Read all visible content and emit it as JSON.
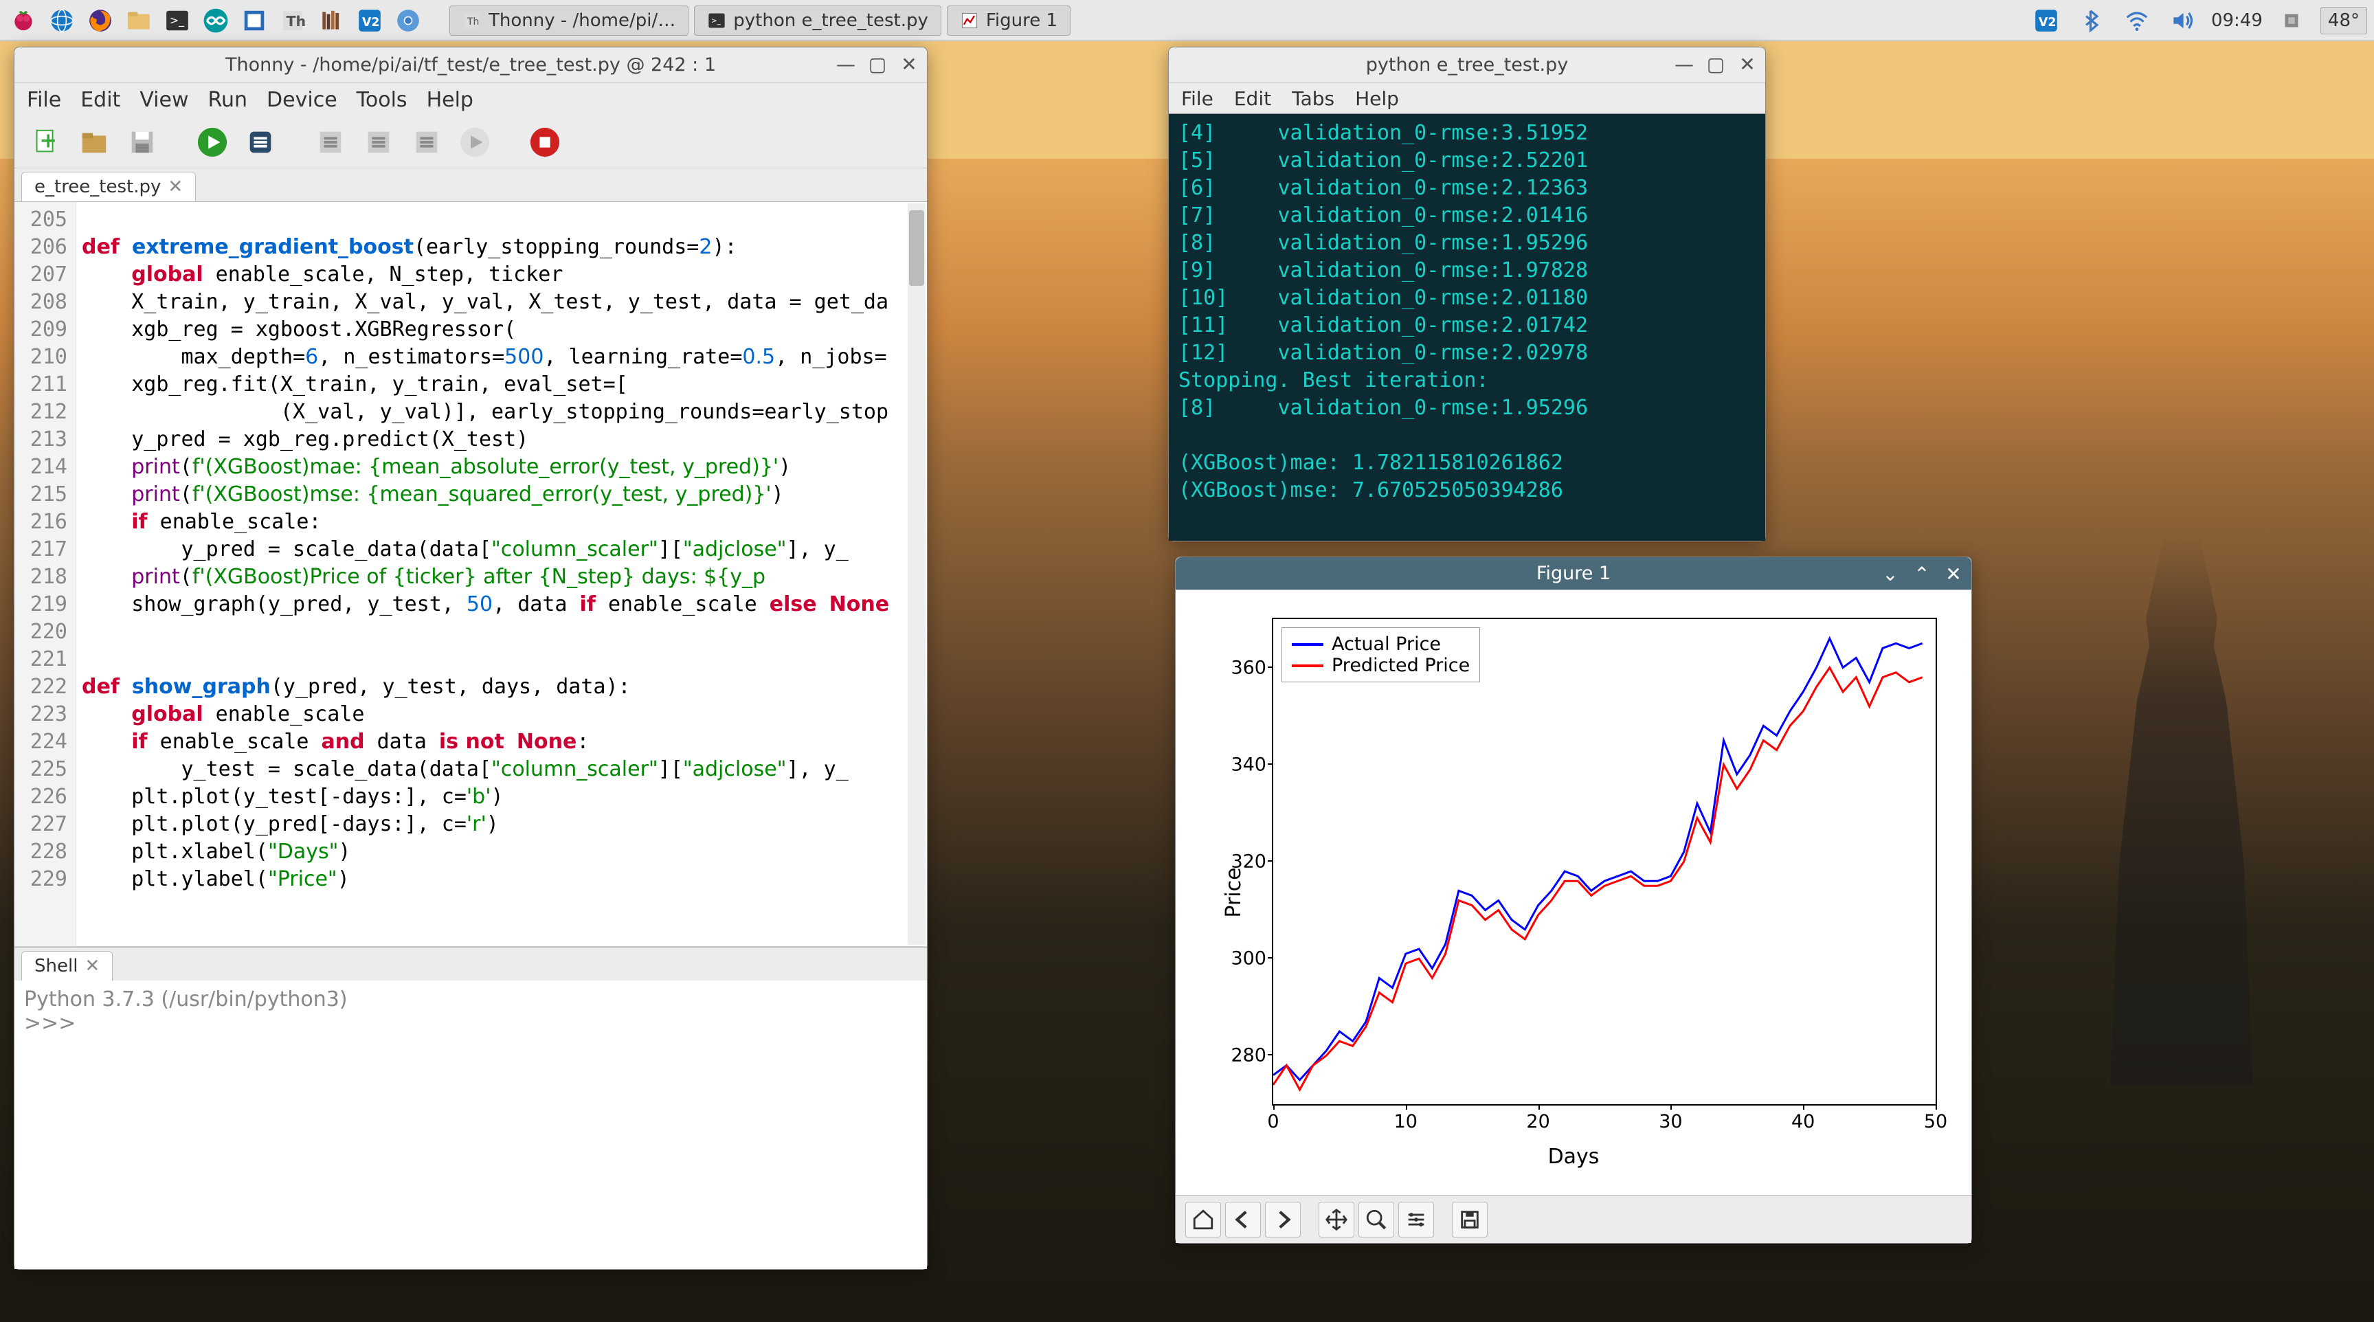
{
  "taskbar": {
    "buttons": [
      {
        "icon": "thonny",
        "label": "Thonny  -  /home/pi/…"
      },
      {
        "icon": "terminal",
        "label": "python e_tree_test.py"
      },
      {
        "icon": "figure",
        "label": "Figure 1"
      }
    ],
    "clock": "09:49",
    "temp": "48°"
  },
  "thonny": {
    "title": "Thonny  -  /home/pi/ai/tf_test/e_tree_test.py  @  242 : 1",
    "menus": [
      "File",
      "Edit",
      "View",
      "Run",
      "Device",
      "Tools",
      "Help"
    ],
    "tab": "e_tree_test.py",
    "first_line": 205,
    "code_lines": [
      "",
      "<kw>def</kw> <def>extreme_gradient_boost</def>(early_stopping_rounds=<num>2</num>):",
      "    <kw>global</kw> enable_scale, N_step, ticker",
      "    X_train, y_train, X_val, y_val, X_test, y_test, data = get_da",
      "    xgb_reg = xgboost.XGBRegressor(",
      "        max_depth=<num>6</num>, n_estimators=<num>500</num>, learning_rate=<num>0.5</num>, n_jobs=",
      "    xgb_reg.fit(X_train, y_train, eval_set=[",
      "                (X_val, y_val)], early_stopping_rounds=early_stop",
      "    y_pred = xgb_reg.predict(X_test)",
      "    <bi>print</bi>(<str>f'(XGBoost)mae: {mean_absolute_error(y_test, y_pred)}'</str>)",
      "    <bi>print</bi>(<str>f'(XGBoost)mse: {mean_squared_error(y_test, y_pred)}'</str>)",
      "    <kw>if</kw> enable_scale:",
      "        y_pred = scale_data(data[<str>\"column_scaler\"</str>][<str>\"adjclose\"</str>], y_",
      "    <bi>print</bw>(<str>f'(XGBoost)Price of {ticker} after {N_step} days: ${y_p</str>",
      "    show_graph(y_pred, y_test, <num>50</num>, data <kw>if</kw> enable_scale <kw>else</kw> <kw>None</kw>",
      "",
      "",
      "<kw>def</kw> <def>show_graph</def>(y_pred, y_test, days, data):",
      "    <kw>global</kw> enable_scale",
      "    <kw>if</kw> enable_scale <kw>and</kw> data <kw>is not</kw> <kw>None</kw>:",
      "        y_test = scale_data(data[<str>\"column_scaler\"</str>][<str>\"adjclose\"</str>], y_",
      "    plt.plot(y_test[-days:], c=<str>'b'</str>)",
      "    plt.plot(y_pred[-days:], c=<str>'r'</str>)",
      "    plt.xlabel(<str>\"Days\"</str>)",
      "    plt.ylabel(<str>\"Price\"</str>)"
    ],
    "shell_tab": "Shell",
    "shell_intro": "Python 3.7.3 (/usr/bin/python3)",
    "shell_prompt": ">>>"
  },
  "terminal": {
    "title": "python e_tree_test.py",
    "menus": [
      "File",
      "Edit",
      "Tabs",
      "Help"
    ],
    "lines": [
      "[4]     validation_0-rmse:3.51952",
      "[5]     validation_0-rmse:2.52201",
      "[6]     validation_0-rmse:2.12363",
      "[7]     validation_0-rmse:2.01416",
      "[8]     validation_0-rmse:1.95296",
      "[9]     validation_0-rmse:1.97828",
      "[10]    validation_0-rmse:2.01180",
      "[11]    validation_0-rmse:2.01742",
      "[12]    validation_0-rmse:2.02978",
      "Stopping. Best iteration:",
      "[8]     validation_0-rmse:1.95296",
      "",
      "(XGBoost)mae: 1.782115810261862",
      "(XGBoost)mse: 7.670525050394286"
    ]
  },
  "figure": {
    "title": "Figure 1",
    "xlabel": "Days",
    "ylabel": "Price",
    "legend": [
      "Actual Price",
      "Predicted Price"
    ],
    "toolbar": [
      "home",
      "back",
      "forward",
      "|",
      "pan",
      "zoom",
      "subplots",
      "|",
      "save"
    ]
  },
  "chart_data": {
    "type": "line",
    "title": "",
    "xlabel": "Days",
    "ylabel": "Price",
    "xlim": [
      0,
      50
    ],
    "ylim": [
      270,
      370
    ],
    "xticks": [
      0,
      10,
      20,
      30,
      40,
      50
    ],
    "yticks": [
      280,
      300,
      320,
      340,
      360
    ],
    "legend_position": "upper-left",
    "series": [
      {
        "name": "Actual Price",
        "color": "#0000ff",
        "x": [
          0,
          1,
          2,
          3,
          4,
          5,
          6,
          7,
          8,
          9,
          10,
          11,
          12,
          13,
          14,
          15,
          16,
          17,
          18,
          19,
          20,
          21,
          22,
          23,
          24,
          25,
          26,
          27,
          28,
          29,
          30,
          31,
          32,
          33,
          34,
          35,
          36,
          37,
          38,
          39,
          40,
          41,
          42,
          43,
          44,
          45,
          46,
          47,
          48,
          49
        ],
        "y": [
          276,
          278,
          275,
          278,
          281,
          285,
          283,
          287,
          296,
          294,
          301,
          302,
          298,
          303,
          314,
          313,
          310,
          312,
          308,
          306,
          311,
          314,
          318,
          317,
          314,
          316,
          317,
          318,
          316,
          316,
          317,
          322,
          332,
          326,
          345,
          338,
          342,
          348,
          346,
          351,
          355,
          360,
          366,
          360,
          362,
          357,
          364,
          365,
          364,
          365
        ]
      },
      {
        "name": "Predicted Price",
        "color": "#ff0000",
        "x": [
          0,
          1,
          2,
          3,
          4,
          5,
          6,
          7,
          8,
          9,
          10,
          11,
          12,
          13,
          14,
          15,
          16,
          17,
          18,
          19,
          20,
          21,
          22,
          23,
          24,
          25,
          26,
          27,
          28,
          29,
          30,
          31,
          32,
          33,
          34,
          35,
          36,
          37,
          38,
          39,
          40,
          41,
          42,
          43,
          44,
          45,
          46,
          47,
          48,
          49
        ],
        "y": [
          274,
          278,
          273,
          278,
          280,
          283,
          282,
          286,
          293,
          291,
          299,
          300,
          296,
          301,
          312,
          311,
          308,
          310,
          306,
          304,
          309,
          312,
          316,
          316,
          313,
          315,
          316,
          317,
          315,
          315,
          316,
          320,
          329,
          324,
          340,
          335,
          339,
          345,
          343,
          348,
          351,
          356,
          360,
          355,
          358,
          352,
          358,
          359,
          357,
          358
        ]
      }
    ]
  }
}
